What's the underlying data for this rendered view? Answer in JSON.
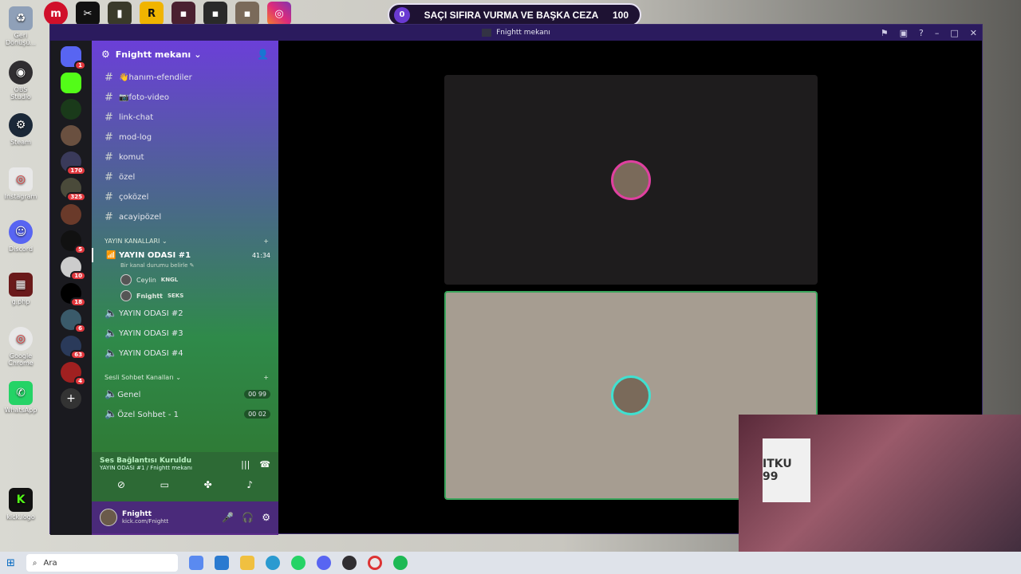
{
  "desktop_icons": [
    {
      "label": "Geri Dönüşü...",
      "icon": "recycle-bin-icon",
      "color": "#8fa0b8"
    },
    {
      "label": "OBS Studio",
      "icon": "obs-icon",
      "color": "#302e31"
    },
    {
      "label": "Steam",
      "icon": "steam-icon",
      "color": "#1b2838"
    },
    {
      "label": "Instagram",
      "icon": "chrome-icon",
      "color": "#e8e8e8"
    },
    {
      "label": "Discord",
      "icon": "discord-icon",
      "color": "#5865f2"
    },
    {
      "label": "g.php",
      "icon": "image-icon",
      "color": "#6a1a1a"
    },
    {
      "label": "Google Chrome",
      "icon": "chrome-icon",
      "color": "#e8e8e8"
    },
    {
      "label": "WhatsApp",
      "icon": "whatsapp-icon",
      "color": "#25d366"
    },
    {
      "label": "kick.logo",
      "icon": "kick-icon",
      "color": "#53fc18"
    }
  ],
  "banner": {
    "left_value": "0",
    "title": "SAÇI SIFIRA VURMA VE BAŞKA CEZA",
    "right_value": "100"
  },
  "window": {
    "title": "Fnightt mekanı"
  },
  "guild_badges": [
    "1",
    "",
    "",
    "",
    "170",
    "325",
    "",
    "5",
    "10",
    "18",
    "6",
    "63",
    "4"
  ],
  "server": {
    "name": "Fnightt mekanı"
  },
  "text_channels": [
    "👋hanım-efendiler",
    "📷foto-video",
    "link-chat",
    "mod-log",
    "komut",
    "özel",
    "çoközel",
    "acayipözel"
  ],
  "categories": {
    "stream": "YAYIN KANALLARI",
    "voice": "Sesli Sohbet Kanalları"
  },
  "active_voice": {
    "name": "YAYIN ODASI #1",
    "timer": "41:34",
    "status": "Bir kanal durumu belirle",
    "users": [
      {
        "name": "Ceylin",
        "tag": "KNGL"
      },
      {
        "name": "Fnightt",
        "tag": "SEKS"
      }
    ]
  },
  "stream_channels": [
    "YAYIN ODASI #2",
    "YAYIN ODASI #3",
    "YAYIN ODASI #4"
  ],
  "voice_channels": [
    {
      "name": "Genel",
      "count": "00",
      "limit": "99"
    },
    {
      "name": "Özel Sohbet - 1",
      "count": "00",
      "limit": "02"
    }
  ],
  "connection": {
    "title": "Ses Bağlantısı Kuruldu",
    "subtitle": "YAYIN ODASI #1 / Fnightt mekanı"
  },
  "user": {
    "name": "Fnightt",
    "status": "kick.com/Fnightt"
  },
  "webcam": {
    "shirt_text": "ITKU 99"
  },
  "taskbar": {
    "search_placeholder": "Ara"
  }
}
